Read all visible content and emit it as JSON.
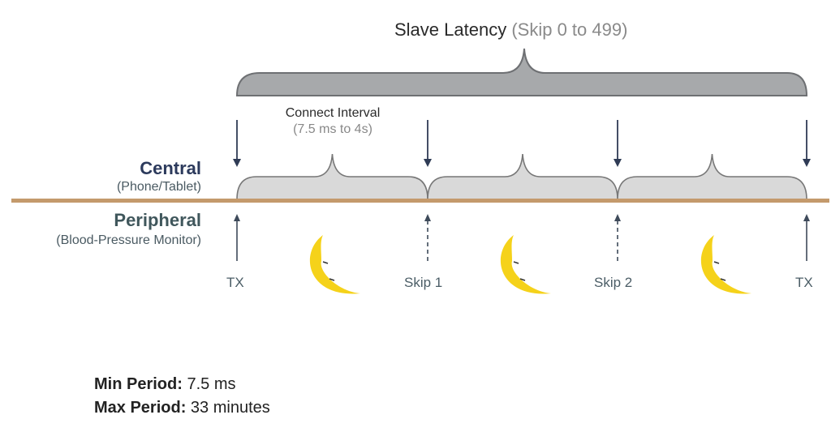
{
  "title": {
    "main": "Slave Latency",
    "sub": "(Skip 0 to 499)"
  },
  "connect_interval": {
    "main": "Connect Interval",
    "sub": "(7.5 ms to 4s)"
  },
  "central": {
    "name": "Central",
    "device": "(Phone/Tablet)"
  },
  "peripheral": {
    "name": "Peripheral",
    "device": "(Blood-Pressure Monitor)"
  },
  "events": [
    {
      "label": "TX",
      "type": "transmit"
    },
    {
      "label": "Skip 1",
      "type": "skip"
    },
    {
      "label": "Skip 2",
      "type": "skip"
    },
    {
      "label": "TX",
      "type": "transmit"
    }
  ],
  "sleep_icons": [
    "moon-icon",
    "moon-icon",
    "moon-icon"
  ],
  "footer": {
    "min_label": "Min Period:",
    "min_value": "7.5 ms",
    "max_label": "Max Period:",
    "max_value": "33 minutes"
  },
  "colors": {
    "timeline": "#c49a6c",
    "brace_big": "#a7a9ab",
    "brace_small": "#d9d9d9",
    "arrow": "#2f3b55",
    "moon": "#f5d21a"
  }
}
